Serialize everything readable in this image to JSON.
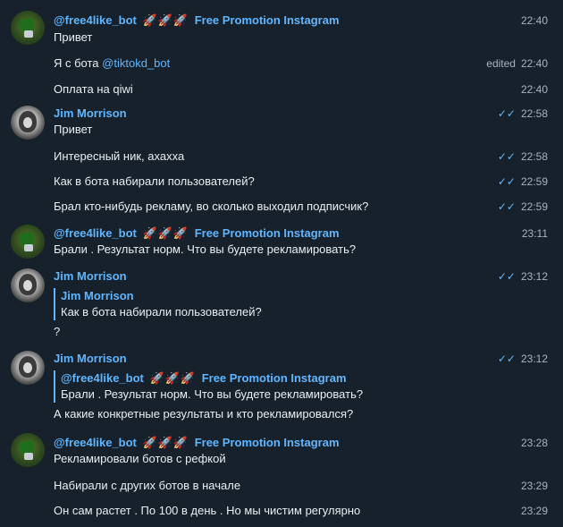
{
  "messages": {
    "m1": {
      "sender_handle": "@free4like_bot",
      "rockets": "🚀🚀🚀",
      "sender_title": "Free Promotion Instagram",
      "time": "22:40",
      "text": "Привет"
    },
    "m2": {
      "prefix": "Я с бота",
      "mention": "@tiktokd_bot",
      "edited": "edited",
      "time": "22:40"
    },
    "m3": {
      "text": "Оплата на qiwi",
      "time": "22:40"
    },
    "m4": {
      "sender": "Jim Morrison",
      "time": "22:58",
      "text": "Привет",
      "ticks": "✓✓"
    },
    "m5": {
      "text": "Интересный ник, ахахха",
      "time": "22:58",
      "ticks": "✓✓"
    },
    "m6": {
      "text": "Как в бота набирали пользователей?",
      "time": "22:59",
      "ticks": "✓✓"
    },
    "m7": {
      "text": "Брал кто-нибудь рекламу, во сколько выходил подписчик?",
      "time": "22:59",
      "ticks": "✓✓"
    },
    "m8": {
      "sender_handle": "@free4like_bot",
      "rockets": "🚀🚀🚀",
      "sender_title": "Free Promotion Instagram",
      "time": "23:11",
      "text": "Брали . Результат норм. Что вы будете рекламировать?"
    },
    "m9": {
      "sender": "Jim Morrison",
      "time": "23:12",
      "ticks": "✓✓",
      "quote_name": "Jim Morrison",
      "quote_text": "Как в бота набирали пользователей?",
      "text": "?"
    },
    "m10": {
      "sender": "Jim Morrison",
      "time": "23:12",
      "ticks": "✓✓",
      "quote_handle": "@free4like_bot",
      "quote_rockets": "🚀🚀🚀",
      "quote_title": "Free Promotion Instagram",
      "quote_text": "Брали . Результат норм. Что вы будете рекламировать?",
      "text": "А какие конкретные результаты и кто рекламировался?"
    },
    "m11": {
      "sender_handle": "@free4like_bot",
      "rockets": "🚀🚀🚀",
      "sender_title": "Free Promotion Instagram",
      "time": "23:28",
      "text": "Рекламировали ботов с рефкой"
    },
    "m12": {
      "text": "Набирали с других ботов в начале",
      "time": "23:29"
    },
    "m13": {
      "text": "Он сам растет . По 100 в день . Но мы чистим регулярно",
      "time": "23:29"
    }
  },
  "icons": {
    "bot_avatar": "bot-avatar",
    "user_avatar": "user-avatar",
    "read_receipt": "double-check-icon"
  },
  "colors": {
    "background": "#17212b",
    "accent": "#5fb6ff",
    "text": "#e9eef3",
    "muted": "#a7b3bf"
  }
}
